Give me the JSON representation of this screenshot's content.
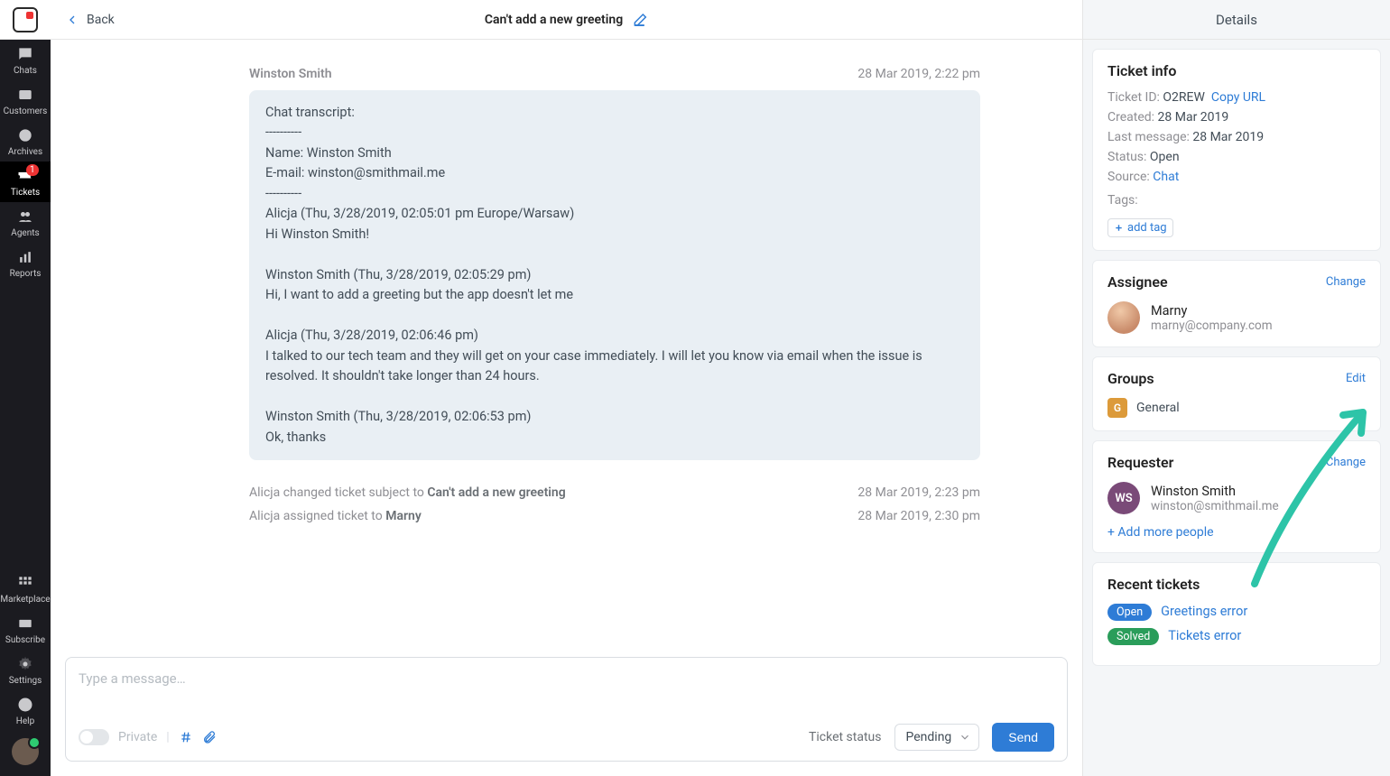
{
  "sidebar": {
    "items": [
      {
        "label": "Chats"
      },
      {
        "label": "Customers"
      },
      {
        "label": "Archives"
      },
      {
        "label": "Tickets",
        "badge": "1"
      },
      {
        "label": "Agents"
      },
      {
        "label": "Reports"
      }
    ],
    "bottom": [
      {
        "label": "Marketplace"
      },
      {
        "label": "Subscribe"
      },
      {
        "label": "Settings"
      },
      {
        "label": "Help"
      }
    ]
  },
  "topbar": {
    "back": "Back",
    "title": "Can't add a new greeting"
  },
  "message": {
    "sender": "Winston Smith",
    "time": "28 Mar 2019, 2:22 pm",
    "lines": [
      "Chat transcript:",
      "----------",
      "Name: Winston Smith",
      "E-mail: winston@smithmail.me",
      "----------",
      "Alicja (Thu, 3/28/2019, 02:05:01 pm Europe/Warsaw)",
      "Hi Winston Smith!",
      "",
      "Winston Smith (Thu, 3/28/2019, 02:05:29 pm)",
      "Hi, I want to add a greeting but the app doesn't let me",
      "",
      "Alicja (Thu, 3/28/2019, 02:06:46 pm)",
      "I talked to our tech team and they will get on your case immediately. I will let you know via email when the issue is resolved. It shouldn't take longer than 24 hours.",
      "",
      "Winston Smith (Thu, 3/28/2019, 02:06:53 pm)",
      "Ok, thanks"
    ]
  },
  "events": [
    {
      "prefix": "Alicja changed ticket subject to ",
      "strong": "Can't add a new greeting",
      "time": "28 Mar 2019, 2:23 pm"
    },
    {
      "prefix": "Alicja assigned ticket to ",
      "strong": "Marny",
      "time": "28 Mar 2019, 2:30 pm"
    }
  ],
  "composer": {
    "placeholder": "Type a message…",
    "private": "Private",
    "statusLabel": "Ticket status",
    "statusValue": "Pending",
    "send": "Send"
  },
  "details": {
    "title": "Details",
    "info": {
      "heading": "Ticket info",
      "ticketIdLabel": "Ticket ID:",
      "ticketId": "O2REW",
      "copy": "Copy URL",
      "createdLabel": "Created:",
      "created": "28 Mar 2019",
      "lastLabel": "Last message:",
      "last": "28 Mar 2019",
      "statusLabel": "Status:",
      "status": "Open",
      "sourceLabel": "Source:",
      "source": "Chat",
      "tagsLabel": "Tags:",
      "addTag": "add tag"
    },
    "assignee": {
      "heading": "Assignee",
      "action": "Change",
      "name": "Marny",
      "email": "marny@company.com"
    },
    "groups": {
      "heading": "Groups",
      "action": "Edit",
      "badge": "G",
      "name": "General"
    },
    "requester": {
      "heading": "Requester",
      "action": "Change",
      "initials": "WS",
      "name": "Winston Smith",
      "email": "winston@smithmail.me",
      "addMore": "+ Add more people"
    },
    "recent": {
      "heading": "Recent tickets",
      "items": [
        {
          "pill": "Open",
          "pillClass": "open",
          "title": "Greetings error"
        },
        {
          "pill": "Solved",
          "pillClass": "solved",
          "title": "Tickets error"
        }
      ]
    }
  }
}
